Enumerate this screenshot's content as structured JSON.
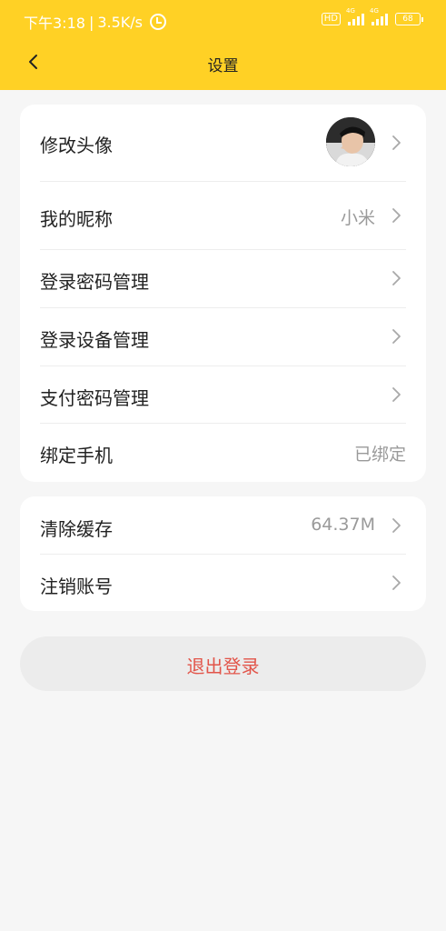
{
  "status_bar": {
    "time": "下午3:18",
    "speed": "3.5K/s",
    "hd": "HD",
    "network1": "4G",
    "network2": "4G",
    "battery": "68"
  },
  "nav": {
    "title": "设置"
  },
  "settings": {
    "avatar_label": "修改头像",
    "nickname_label": "我的昵称",
    "nickname_value": "小米",
    "login_password_label": "登录密码管理",
    "login_device_label": "登录设备管理",
    "pay_password_label": "支付密码管理",
    "phone_label": "绑定手机",
    "phone_value": "已绑定"
  },
  "storage": {
    "cache_label": "清除缓存",
    "cache_value": "64.37M",
    "cancel_account_label": "注销账号"
  },
  "logout": {
    "label": "退出登录"
  },
  "colors": {
    "header": "#ffd125",
    "logout_text": "#e2554a",
    "background": "#f6f6f6"
  }
}
